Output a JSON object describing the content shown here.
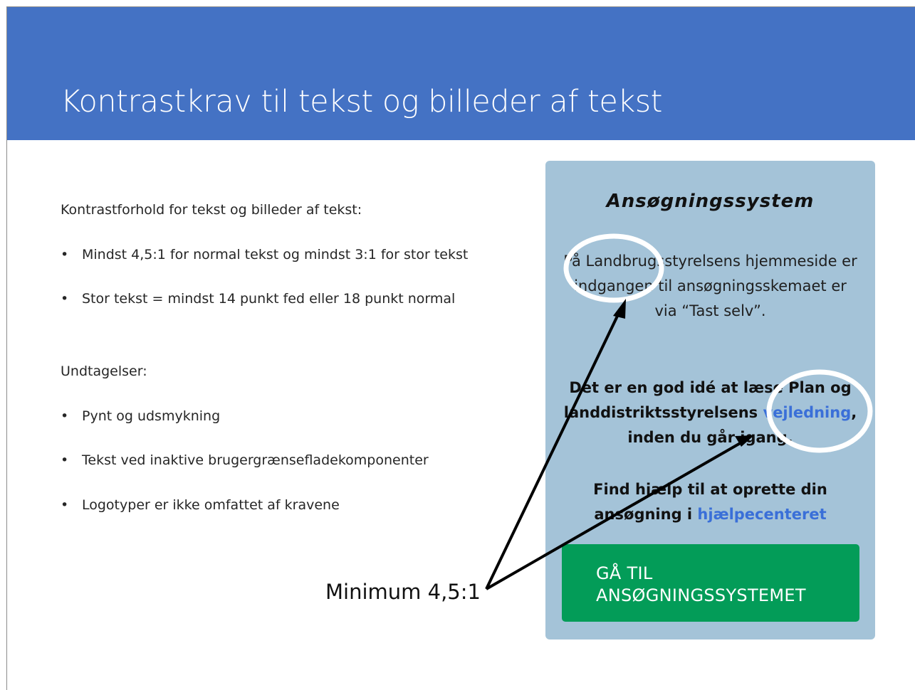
{
  "slide": {
    "title": "Kontrastkrav til tekst og billeder af tekst",
    "intro": "Kontrastforhold for tekst og billeder af tekst:",
    "bullets": [
      "Mindst 4,5:1 for normal tekst og mindst 3:1 for stor tekst",
      "Stor tekst = mindst 14 punkt fed eller 18 punkt normal"
    ],
    "exceptions_heading": "Undtagelser:",
    "exceptions": [
      "Pynt og udsmykning",
      "Tekst ved inaktive brugergrænsefladekomponenter",
      "Logotyper er ikke omfattet af kravene"
    ],
    "bullet_char": "•"
  },
  "panel": {
    "title": "Ansøgningssystem",
    "para1": "På Landbrugsstyrelsens hjemmeside er indgangen til ansøgningsskemaet er via “Tast selv”.",
    "para2_before": "Det er en god idé at læse Plan og landdistriktsstyrelsens ",
    "para2_link": "vejledning",
    "para2_after": ", inden du går igang.",
    "para3_before": "Find hjælp til at oprette din ansøgning i ",
    "para3_link": "hjælpecenteret",
    "button_line1": "GÅ TIL",
    "button_line2": "ANSØGNINGSSYSTEMET"
  },
  "annotation": {
    "label": "Minimum 4,5:1"
  },
  "colors": {
    "header": "#4472c4",
    "panel": "#a4c3d8",
    "button": "#039c58",
    "link": "#3a6fd8"
  }
}
